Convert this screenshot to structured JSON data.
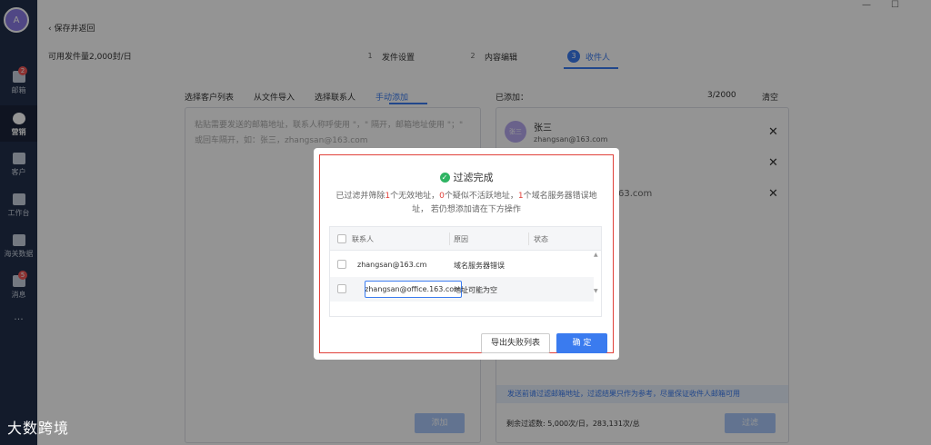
{
  "sidebar": {
    "avatar_letter": "A",
    "items": [
      {
        "label": "邮箱",
        "icon": "mail-icon",
        "badge": "2"
      },
      {
        "label": "营销",
        "icon": "pie-chart-icon",
        "badge": ""
      },
      {
        "label": "客户",
        "icon": "user-icon",
        "badge": ""
      },
      {
        "label": "工作台",
        "icon": "grid-icon",
        "badge": ""
      },
      {
        "label": "海关数据",
        "icon": "bar-chart-icon",
        "badge": ""
      },
      {
        "label": "消息",
        "icon": "chat-icon",
        "badge": "5"
      }
    ],
    "more": "···"
  },
  "header": {
    "back": "‹ 保存并返回",
    "quota": "可用发件量2,000封/日",
    "steps": [
      {
        "num": "1",
        "label": "发件设置"
      },
      {
        "num": "2",
        "label": "内容编辑"
      },
      {
        "num": "3",
        "label": "收件人"
      }
    ],
    "window_min": "—",
    "window_max": "☐"
  },
  "left": {
    "tabs": [
      "选择客户列表",
      "从文件导入",
      "选择联系人",
      "手动添加"
    ],
    "placeholder": "粘贴需要发送的邮箱地址，联系人称呼使用 \"，\" 隔开，邮箱地址使用 \"；\" 或回车隔开，如：张三，zhangsan@163.com",
    "add_button": "添加"
  },
  "right": {
    "title": "已添加：",
    "count": "3/2000",
    "clear": "清空",
    "contact": {
      "avatar": "张三",
      "name": "张三",
      "email": "zhangsan@163.com"
    },
    "partial_email": "63.com",
    "hint": "发送前请过滤邮箱地址，过滤结果只作为参考，尽量保证收件人邮箱可用",
    "remaining": "剩余过滤数: 5,000次/日，283,131次/总",
    "filter_button": "过滤"
  },
  "modal": {
    "title": "过滤完成",
    "desc_prefix": "已过滤并筛除",
    "n_invalid": "1",
    "desc_invalid": "个无效地址，",
    "n_inactive": "0",
    "desc_inactive": "个疑似不活跃地址，",
    "n_domain": "1",
    "desc_domain": "个域名服务器错误地址，  若仍想添加请在下方操作",
    "columns": [
      "联系人",
      "原因",
      "状态"
    ],
    "rows": [
      {
        "contact": "zhangsan@163.cm",
        "reason": "域名服务器错误",
        "status": ""
      },
      {
        "contact": "zhangsan@office.163.com",
        "reason": "地址可能为空",
        "status": ""
      }
    ],
    "export_button": "导出失败列表",
    "ok_button": "确 定"
  },
  "watermark": "大数跨境"
}
